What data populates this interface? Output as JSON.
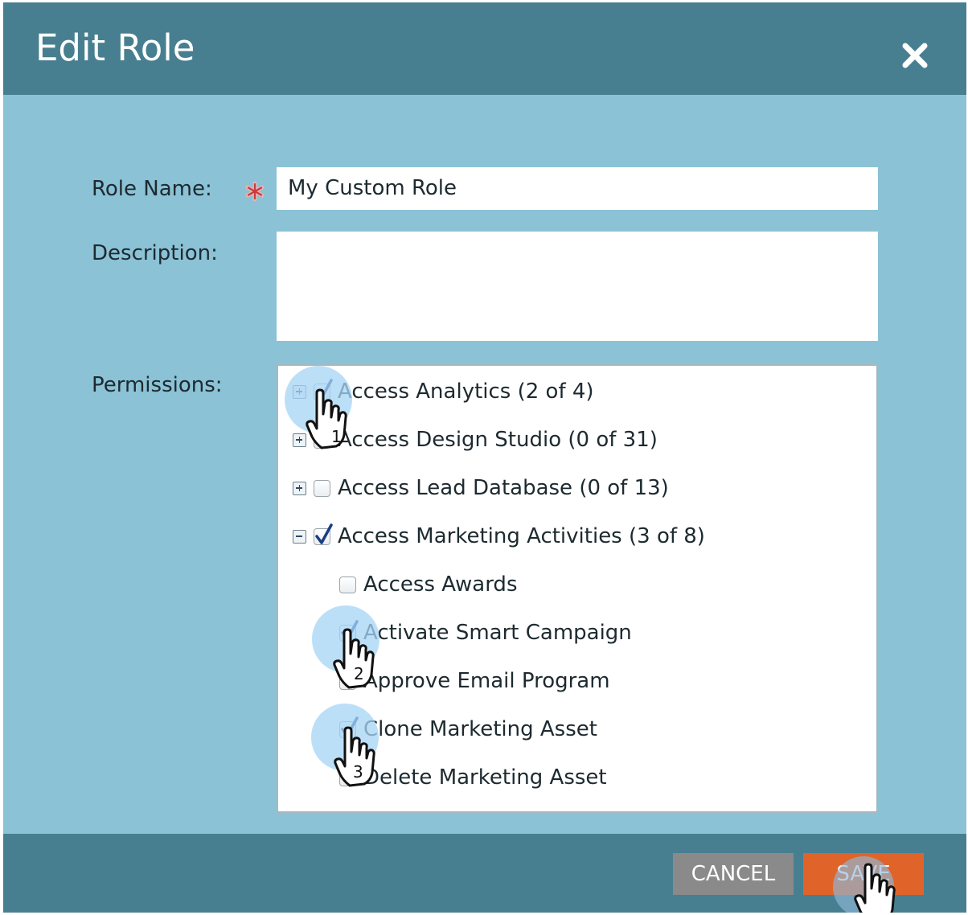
{
  "dialog": {
    "title": "Edit Role",
    "close_icon": "close-icon"
  },
  "form": {
    "role_name_label": "Role Name:",
    "role_name_value": "My Custom Role",
    "required_marker_icon": "asterisk-icon",
    "description_label": "Description:",
    "description_value": "",
    "permissions_label": "Permissions:"
  },
  "permissions": {
    "items": [
      {
        "label": "Access Analytics (2 of 4)",
        "level": 0,
        "expander": "plus",
        "checked": true
      },
      {
        "label": "Access Design Studio (0 of 31)",
        "level": 0,
        "expander": "plus",
        "checked": false
      },
      {
        "label": "Access Lead Database (0 of 13)",
        "level": 0,
        "expander": "plus",
        "checked": false
      },
      {
        "label": "Access Marketing Activities (3 of 8)",
        "level": 0,
        "expander": "minus",
        "checked": true
      },
      {
        "label": "Access Awards",
        "level": 1,
        "checked": false
      },
      {
        "label": "Activate Smart Campaign",
        "level": 1,
        "checked": true
      },
      {
        "label": "Approve Email Program",
        "level": 1,
        "checked": false
      },
      {
        "label": "Clone Marketing Asset",
        "level": 1,
        "checked": true
      },
      {
        "label": "Delete Marketing Asset",
        "level": 1,
        "checked": false
      }
    ]
  },
  "hints": [
    {
      "number": "1",
      "icon": "hand-pointer-icon"
    },
    {
      "number": "2",
      "icon": "hand-pointer-icon"
    },
    {
      "number": "3",
      "icon": "hand-pointer-icon"
    },
    {
      "number": "",
      "icon": "hand-pointer-icon"
    }
  ],
  "footer": {
    "cancel_label": "CANCEL",
    "save_label": "SAVE"
  },
  "colors": {
    "header": "#487f90",
    "body": "#8bc2d5",
    "save": "#e0642a",
    "cancel": "#8a8a8a",
    "hint_bubble": "#a6d4f5"
  }
}
